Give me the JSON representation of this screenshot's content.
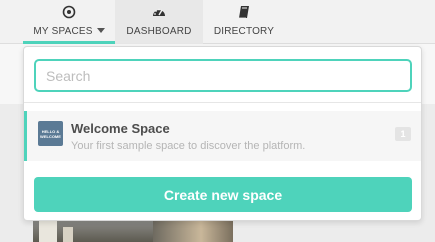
{
  "nav": {
    "items": [
      {
        "label": "MY SPACES",
        "icon": "target-icon",
        "active": true
      },
      {
        "label": "DASHBOARD",
        "icon": "speedometer-icon",
        "active": false
      },
      {
        "label": "DIRECTORY",
        "icon": "book-icon",
        "active": false
      }
    ]
  },
  "dropdown": {
    "search_placeholder": "Search",
    "spaces": [
      {
        "title": "Welcome Space",
        "description": "Your first sample space to discover the platform.",
        "thumb_text": "HELLO & WELCOME",
        "badge": "1"
      }
    ],
    "create_label": "Create new space"
  },
  "colors": {
    "accent": "#4ed3bb",
    "thumb": "#5b7a95"
  }
}
